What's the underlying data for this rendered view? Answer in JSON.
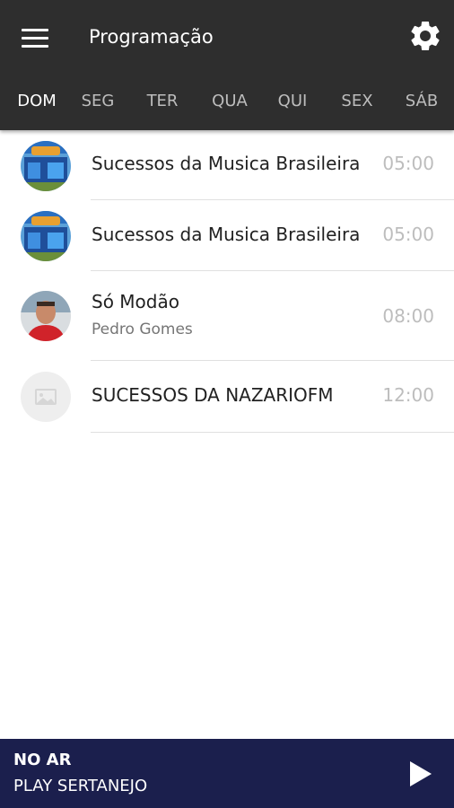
{
  "header": {
    "title": "Programação",
    "menu_icon": "hamburger-menu-icon",
    "settings_icon": "gear-icon"
  },
  "tabs": [
    {
      "label": "DOM",
      "active": true
    },
    {
      "label": "SEG",
      "active": false
    },
    {
      "label": "TER",
      "active": false
    },
    {
      "label": "QUA",
      "active": false
    },
    {
      "label": "QUI",
      "active": false
    },
    {
      "label": "SEX",
      "active": false
    },
    {
      "label": "SÁB",
      "active": false
    }
  ],
  "schedule": [
    {
      "title": "Sucessos da Musica Brasileira",
      "subtitle": "",
      "time": "05:00",
      "avatar": "station-photo"
    },
    {
      "title": "Sucessos da Musica Brasileira",
      "subtitle": "",
      "time": "05:00",
      "avatar": "station-photo"
    },
    {
      "title": "Só Modão",
      "subtitle": "Pedro Gomes",
      "time": "08:00",
      "avatar": "host-photo"
    },
    {
      "title": "SUCESSOS DA NAZARIOFM",
      "subtitle": "",
      "time": "12:00",
      "avatar": "image-placeholder-icon"
    }
  ],
  "player": {
    "status": "NO AR",
    "station": "PLAY SERTANEJO",
    "play_icon": "play-icon"
  },
  "colors": {
    "appbar": "#2e2e2e",
    "player": "#1b1f4d",
    "divider": "#e0e0e0",
    "time": "#bdbdbd"
  }
}
